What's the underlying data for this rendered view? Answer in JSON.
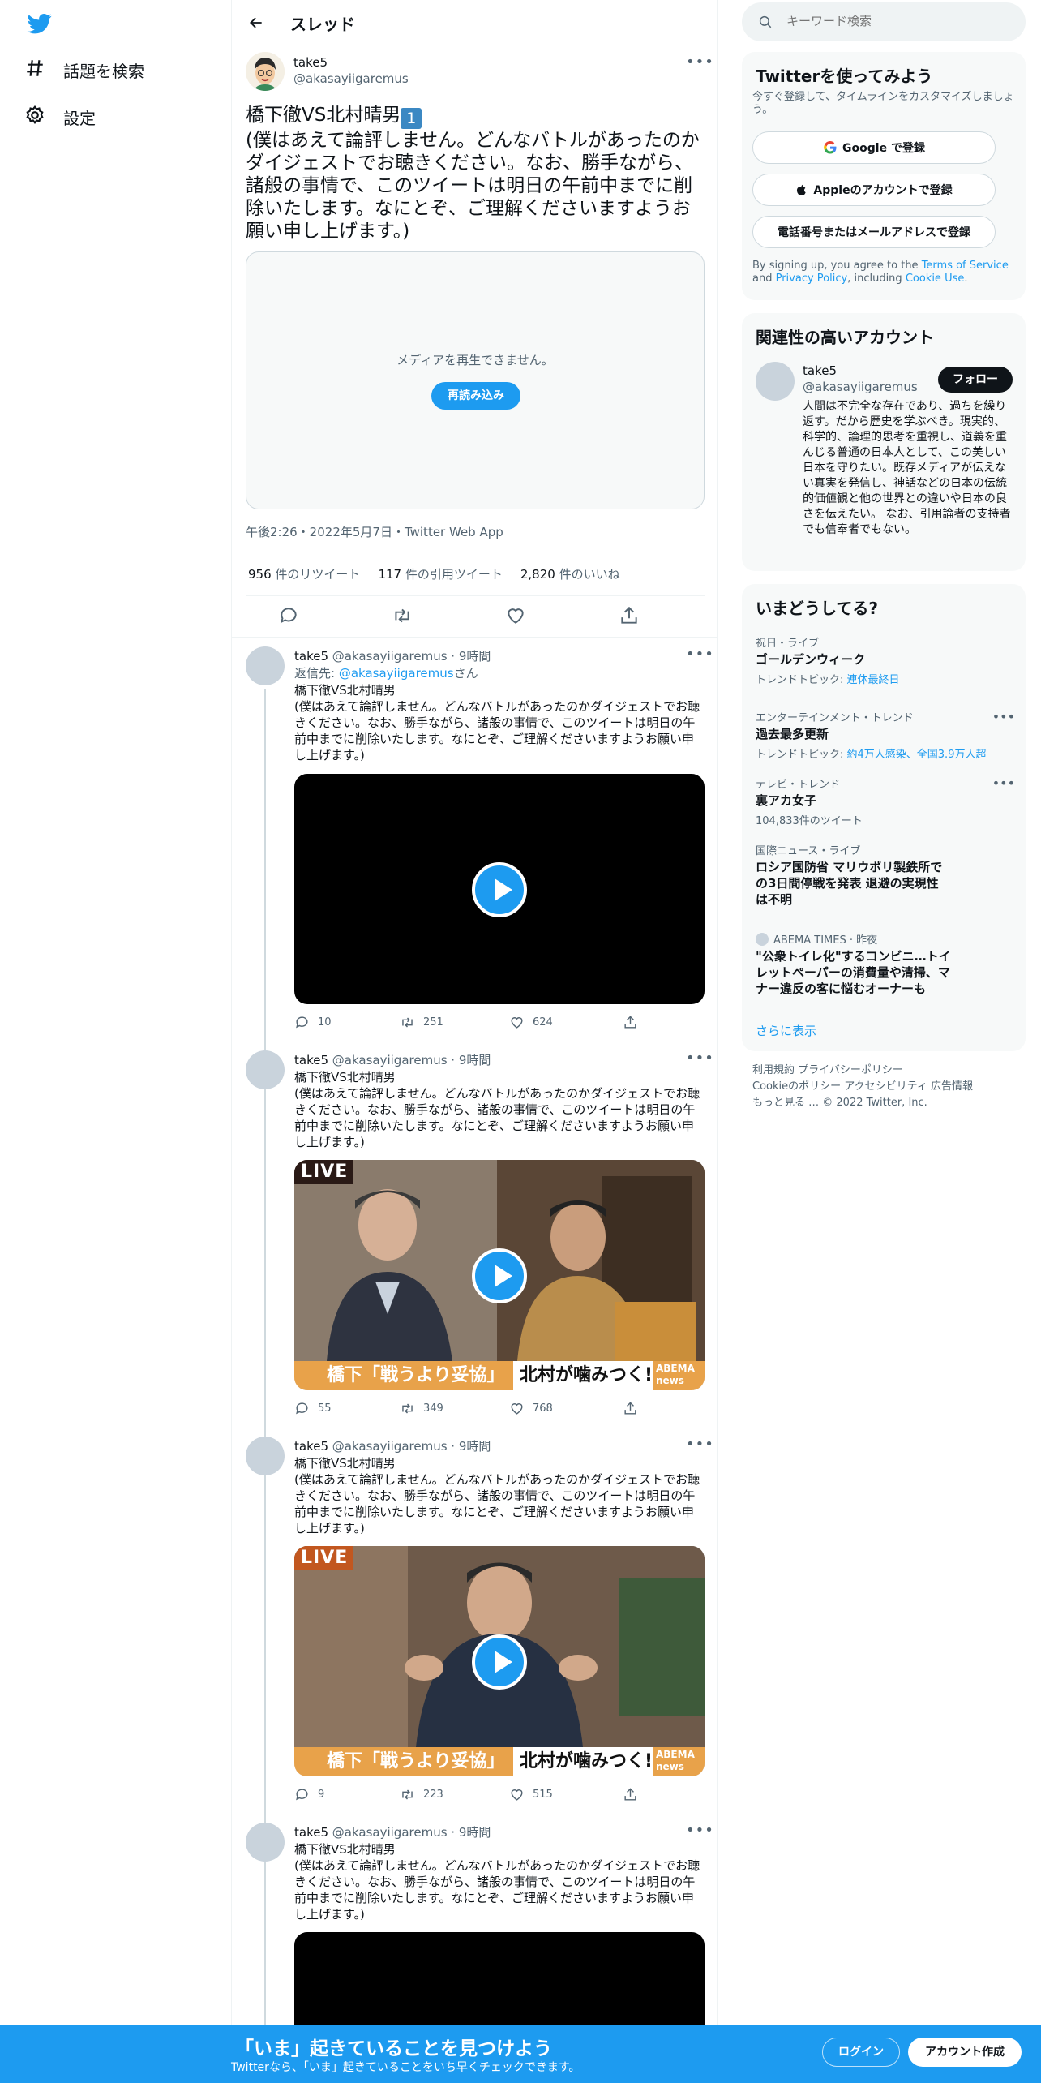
{
  "nav": {
    "items": [
      {
        "label": "話題を検索",
        "icon": "hashtag-icon"
      },
      {
        "label": "設定",
        "icon": "gear-icon"
      }
    ]
  },
  "header": {
    "title": "スレッド"
  },
  "tweet": {
    "name": "take5",
    "handle": "@akasayiigaremus",
    "text_line1": "橋下徹VS北村晴男",
    "badge": "1",
    "text_body": "(僕はあえて論評しません。どんなバトルがあったのかダイジェストでお聴きください。なお、勝手ながら、諸般の事情で、このツイートは明日の午前中までに削除いたします。なにとぞ、ご理解くださいますようお願い申し上げます。)",
    "media_message": "メディアを再生できません。",
    "reload_label": "再読み込み",
    "timestamp": "午後2:26・2022年5月7日・Twitter Web App",
    "retweets": {
      "count": "956",
      "label": "件のリツイート"
    },
    "quotes": {
      "count": "117",
      "label": "件の引用ツイート"
    },
    "likes": {
      "count": "2,820",
      "label": "件のいいね"
    }
  },
  "replies": [
    {
      "name": "take5",
      "meta": "@akasayiigaremus · 9時間",
      "reply_to_prefix": "返信先: ",
      "reply_to_handle": "@akasayiigaremus",
      "reply_to_suffix": "さん",
      "text": "橋下徹VS北村晴男\n(僕はあえて論評しません。どんなバトルがあったのかダイジェストでお聴きください。なお、勝手ながら、諸般の事情で、このツイートは明日の午前中までに削除いたします。なにとぞ、ご理解くださいますようお願い申し上げます。)",
      "replies": "10",
      "retweets": "251",
      "likes": "624"
    },
    {
      "name": "take5",
      "meta": "@akasayiigaremus · 9時間",
      "text": "橋下徹VS北村晴男\n(僕はあえて論評しません。どんなバトルがあったのかダイジェストでお聴きください。なお、勝手ながら、諸般の事情で、このツイートは明日の午前中までに削除いたします。なにとぞ、ご理解くださいますようお願い申し上げます。)",
      "live_label": "LIVE",
      "banner_left": "橋下「戦うより妥協」論",
      "banner_right": "北村が噛みつく!",
      "banner_brand": "ABEMA news",
      "replies": "55",
      "retweets": "349",
      "likes": "768"
    },
    {
      "name": "take5",
      "meta": "@akasayiigaremus · 9時間",
      "text": "橋下徹VS北村晴男\n(僕はあえて論評しません。どんなバトルがあったのかダイジェストでお聴きください。なお、勝手ながら、諸般の事情で、このツイートは明日の午前中までに削除いたします。なにとぞ、ご理解くださいますようお願い申し上げます。)",
      "live_label": "LIVE",
      "banner_left": "橋下「戦うより妥協」論",
      "banner_right": "北村が噛みつく!",
      "banner_brand": "ABEMA news",
      "replies": "9",
      "retweets": "223",
      "likes": "515"
    },
    {
      "name": "take5",
      "meta": "@akasayiigaremus · 9時間",
      "text": "橋下徹VS北村晴男\n(僕はあえて論評しません。どんなバトルがあったのかダイジェストでお聴きください。なお、勝手ながら、諸般の事情で、このツイートは明日の午前中までに削除いたします。なにとぞ、ご理解くださいますようお願い申し上げます。)"
    }
  ],
  "search": {
    "placeholder": "キーワード検索"
  },
  "signup_panel": {
    "title": "Twitterを使ってみよう",
    "subtitle": "今すぐ登録して、タイムラインをカスタマイズしましょう。",
    "google": "Google で登録",
    "apple": "Appleのアカウントで登録",
    "phone": "電話番号またはメールアドレスで登録",
    "terms_1": "By signing up, you agree to the ",
    "terms_tos": "Terms of Service",
    "terms_2": " and ",
    "terms_privacy": "Privacy Policy",
    "terms_3": ", including ",
    "terms_cookie": "Cookie Use",
    "terms_4": "."
  },
  "related": {
    "title": "関連性の高いアカウント",
    "name": "take5",
    "handle": "@akasayiigaremus",
    "follow": "フォロー",
    "bio": "人間は不完全な存在であり、過ちを繰り返す。だから歴史を学ぶべき。現実的、科学的、論理的思考を重視し、道義を重んじる普通の日本人として、この美しい日本を守りたい。既存メディアが伝えない真実を発信し、神話などの日本の伝統的価値観と他の世界との違いや日本の良さを伝えたい。 なお、引用論者の支持者でも信奉者でもない。"
  },
  "trends": {
    "title": "いまどうしてる?",
    "items": [
      {
        "meta": "祝日・ライブ",
        "name": "ゴールデンウィーク",
        "sub_prefix": "トレンドトピック: ",
        "sub_link": "連休最終日"
      },
      {
        "meta": "エンターテインメント・トレンド",
        "name": "過去最多更新",
        "sub_prefix": "トレンドトピック: ",
        "sub_link": "約4万人感染、全国3.9万人超"
      },
      {
        "meta": "テレビ・トレンド",
        "name": "裏アカ女子",
        "sub_prefix": "104,833件のツイート",
        "sub_link": ""
      },
      {
        "meta": "国際ニュース・ライブ",
        "name": "ロシア国防省 マリウポリ製鉄所での3日間停戦を発表 退避の実現性は不明",
        "sub_prefix": "",
        "sub_link": ""
      },
      {
        "meta": "ABEMA TIMES · 昨夜",
        "name": "\"公衆トイレ化\"するコンビニ…トイレットペーパーの消費量や清掃、マナー違反の客に悩むオーナーも",
        "sub_prefix": "",
        "sub_link": ""
      }
    ],
    "show_more": "さらに表示"
  },
  "footer": {
    "line1": "利用規約   プライバシーポリシー",
    "line2": "Cookieのポリシー   アクセシビリティ   広告情報",
    "line3": "もっと見る …   © 2022 Twitter, Inc."
  },
  "bottombar": {
    "title": "「いま」起きていることを見つけよう",
    "subtitle": "Twitterなら、「いま」起きていることをいち早くチェックできます。",
    "login": "ログイン",
    "signup": "アカウント作成"
  },
  "colors": {
    "accent": "#1d9bf0",
    "text": "#0f1419",
    "secondary": "#536471",
    "border": "#eff3f4"
  }
}
